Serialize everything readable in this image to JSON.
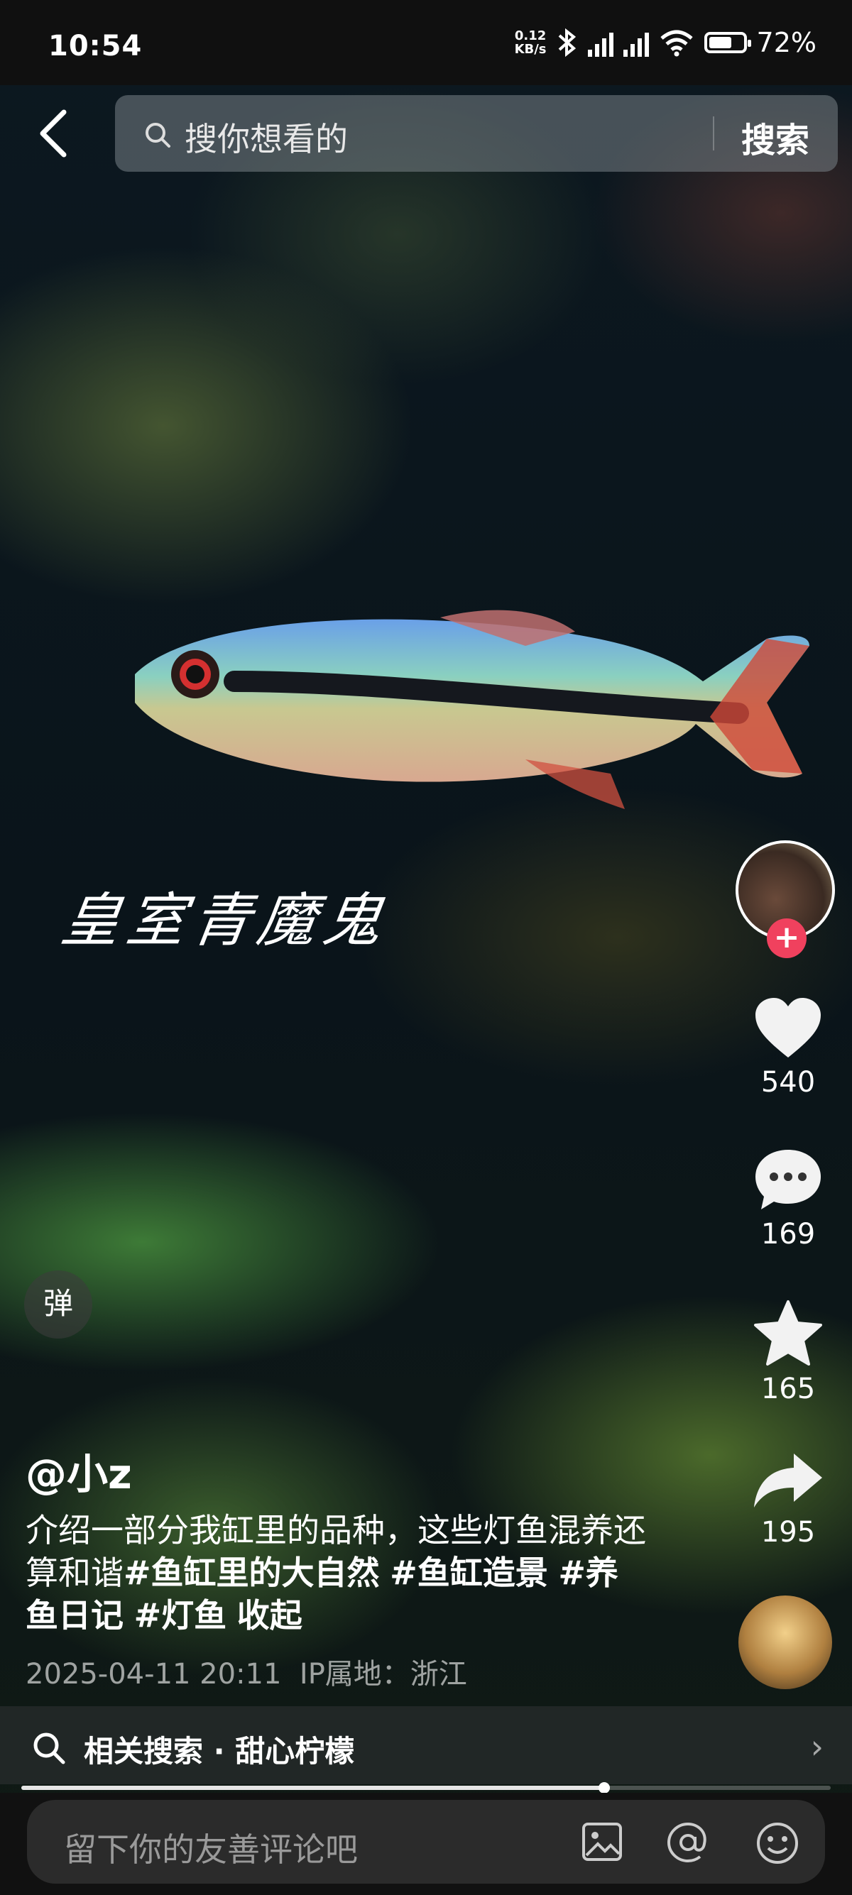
{
  "status_bar": {
    "time": "10:54",
    "net_speed_value": "0.12",
    "net_speed_unit": "KB/s",
    "battery": "72%",
    "battery_level": 0.72
  },
  "search": {
    "placeholder": "搜你想看的",
    "button": "搜索"
  },
  "video_overlay_text": "皇室青魔鬼",
  "actions": {
    "like_count": "540",
    "comment_count": "169",
    "favorite_count": "165",
    "share_count": "195"
  },
  "danmu_label": "弹",
  "post": {
    "author": "@小z",
    "description": "介绍一部分我缸里的品种，这些灯鱼混养还算和谐",
    "tags": [
      "#鱼缸里的大自然",
      "#鱼缸造景",
      "#养鱼日记",
      "#灯鱼"
    ],
    "collapse": "收起",
    "datetime": "2025-04-11 20:11",
    "ip_location": "IP属地：浙江"
  },
  "related_search": "相关搜索 · 甜心柠檬",
  "playback_progress": 0.72,
  "comment_bar": {
    "placeholder": "留下你的友善评论吧"
  },
  "icons": [
    "back-icon",
    "search-icon",
    "heart-icon",
    "comment-icon",
    "star-icon",
    "share-icon",
    "image-icon",
    "at-icon",
    "emoji-icon",
    "chevron-right-icon",
    "plus-icon"
  ],
  "colors": {
    "accent": "#f0415e"
  }
}
